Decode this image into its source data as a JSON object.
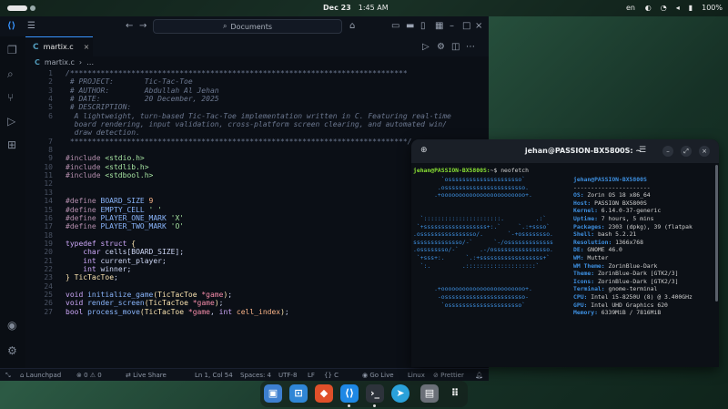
{
  "topbar": {
    "date": "Dec 23",
    "time": "1:45 AM",
    "language": "en",
    "battery": "100%"
  },
  "vscode": {
    "search_placeholder": "Documents",
    "tab_label": "martix.c",
    "breadcrumb": "martix.c",
    "file_icon": "C",
    "line_numbers": [
      "1",
      "2",
      "3",
      "4",
      "5",
      "6",
      "",
      "",
      "7",
      "8",
      "9",
      "10",
      "11",
      "12",
      "13",
      "14",
      "15",
      "16",
      "17",
      "18",
      "19",
      "20",
      "21",
      "22",
      "23",
      "24",
      "25",
      "26",
      "27",
      "28"
    ],
    "status": {
      "launchpad": "Launchpad",
      "errors": "0",
      "warnings": "0",
      "live_share": "Live Share",
      "cursor": "Ln 1, Col 54",
      "spaces": "Spaces: 4",
      "encoding": "UTF-8",
      "eol": "LF",
      "language": "C",
      "go_live": "Go Live",
      "os": "Linux",
      "prettier": "Prettier"
    }
  },
  "terminal": {
    "title": "jehan@PASSION-BX5800S: ~",
    "prompt_user": "jehan@PASSION-BX5800S:",
    "prompt_path": "~$ neofetch",
    "info_host": "jehan@PASSION-BX5800S",
    "info_sep": "----------------------",
    "info": [
      {
        "k": "OS",
        "v": " Zorin OS 18 x86_64"
      },
      {
        "k": "Host",
        "v": " PASSION BX5800S"
      },
      {
        "k": "Kernel",
        "v": " 6.14.0-37-generic"
      },
      {
        "k": "Uptime",
        "v": " 7 hours, 5 mins"
      },
      {
        "k": "Packages",
        "v": " 2303 (dpkg), 39 (flatpak"
      },
      {
        "k": "Shell",
        "v": " bash 5.2.21"
      },
      {
        "k": "Resolution",
        "v": " 1366x768"
      },
      {
        "k": "DE",
        "v": " GNOME 46.0"
      },
      {
        "k": "WM",
        "v": " Mutter"
      },
      {
        "k": "WM Theme",
        "v": " ZorinBlue-Dark"
      },
      {
        "k": "Theme",
        "v": " ZorinBlue-Dark [GTK2/3]"
      },
      {
        "k": "Icons",
        "v": " ZorinBlue-Dark [GTK2/3]"
      },
      {
        "k": "Terminal",
        "v": " gnome-terminal"
      },
      {
        "k": "CPU",
        "v": " Intel i5-8250U (8) @ 3.400GHz"
      },
      {
        "k": "GPU",
        "v": " Intel UHD Graphics 620"
      },
      {
        "k": "Memory",
        "v": " 6339MiB / 7816MiB"
      }
    ],
    "logo": [
      "        `osssssssssssssssssssso`",
      "       .osssssssssssssssssssssso.",
      "      .+oooooooooooooooooooooooo+.",
      "",
      "",
      "  `::::::::::::::::::::::.         .:`",
      " `+ssssssssssssssssss+:.`     `.:+ssso`",
      ".ossssssssssssssso/.       `-+ossssssso.",
      "ssssssssssssso/-`      `-/osssssssssssss",
      ".ossssssso/-`      .-/ossssssssssssssso.",
      " `+sss+:.      `.:+ssssssssssssssssss+`",
      "  `:.         .::::::::::::::::::::`",
      "",
      "",
      "      .+oooooooooooooooooooooooo+.",
      "       -osssssssssssssssssssssso-",
      "        `osssssssssssssssssssso`"
    ],
    "colors": {
      "row1": [
        "#000000",
        "#cc0000",
        "#4e9a06",
        "#c4a000",
        "#3465a4",
        "#75507b",
        "#06989a",
        "#d3d7cf"
      ],
      "row2": [
        "#555753",
        "#ef2929",
        "#8ae234",
        "#fce94f",
        "#729fcf",
        "#ad7fa8",
        "#34e2e2",
        "#eeeeec"
      ]
    }
  },
  "dock": {
    "apps": [
      "files-icon",
      "store-icon",
      "brave-icon",
      "vscode-icon",
      "terminal-icon",
      "telegram-icon",
      "trash-icon",
      "app-grid-icon"
    ]
  }
}
